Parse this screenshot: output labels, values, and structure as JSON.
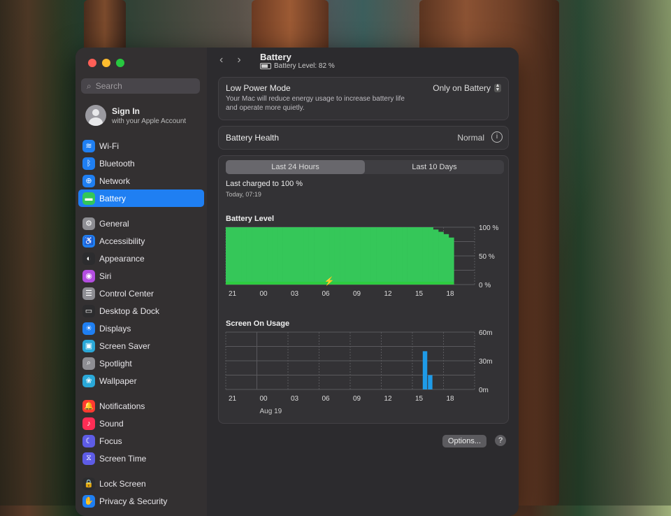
{
  "window": {
    "title": "Battery",
    "subtitle": "Battery Level: 82 %"
  },
  "sidebar": {
    "search_placeholder": "Search",
    "account": {
      "title": "Sign In",
      "subtitle": "with your Apple Account"
    },
    "groups": [
      [
        {
          "label": "Wi-Fi",
          "icon": "wifi-icon",
          "color": "#1f7ff2",
          "glyph": "≋"
        },
        {
          "label": "Bluetooth",
          "icon": "bluetooth-icon",
          "color": "#1f7ff2",
          "glyph": "ᛒ"
        },
        {
          "label": "Network",
          "icon": "globe-icon",
          "color": "#1f7ff2",
          "glyph": "⊕"
        },
        {
          "label": "Battery",
          "icon": "battery-icon",
          "color": "#34c759",
          "glyph": "▬",
          "active": true
        }
      ],
      [
        {
          "label": "General",
          "icon": "gear-icon",
          "color": "#8e8e93",
          "glyph": "⚙"
        },
        {
          "label": "Accessibility",
          "icon": "accessibility-icon",
          "color": "#1f7ff2",
          "glyph": "♿"
        },
        {
          "label": "Appearance",
          "icon": "appearance-icon",
          "color": "#2c2c2e",
          "glyph": "◐"
        },
        {
          "label": "Siri",
          "icon": "siri-icon",
          "color": "#b34de0",
          "glyph": "◉"
        },
        {
          "label": "Control Center",
          "icon": "control-center-icon",
          "color": "#8e8e93",
          "glyph": "☰"
        },
        {
          "label": "Desktop & Dock",
          "icon": "dock-icon",
          "color": "#2c2c2e",
          "glyph": "▭"
        },
        {
          "label": "Displays",
          "icon": "displays-icon",
          "color": "#1f7ff2",
          "glyph": "☀"
        },
        {
          "label": "Screen Saver",
          "icon": "screen-saver-icon",
          "color": "#2aa8d8",
          "glyph": "▣"
        },
        {
          "label": "Spotlight",
          "icon": "spotlight-icon",
          "color": "#8e8e93",
          "glyph": "⌕"
        },
        {
          "label": "Wallpaper",
          "icon": "wallpaper-icon",
          "color": "#2aa8d8",
          "glyph": "❀"
        }
      ],
      [
        {
          "label": "Notifications",
          "icon": "notifications-icon",
          "color": "#ff3b30",
          "glyph": "🔔"
        },
        {
          "label": "Sound",
          "icon": "sound-icon",
          "color": "#ff2d55",
          "glyph": "♪"
        },
        {
          "label": "Focus",
          "icon": "focus-icon",
          "color": "#5e5ce6",
          "glyph": "☾"
        },
        {
          "label": "Screen Time",
          "icon": "screen-time-icon",
          "color": "#5e5ce6",
          "glyph": "⧖"
        }
      ],
      [
        {
          "label": "Lock Screen",
          "icon": "lock-icon",
          "color": "#2c2c2e",
          "glyph": "🔒"
        },
        {
          "label": "Privacy & Security",
          "icon": "privacy-icon",
          "color": "#1f7ff2",
          "glyph": "✋"
        }
      ]
    ]
  },
  "low_power": {
    "title": "Low Power Mode",
    "description": "Your Mac will reduce energy usage to increase battery life and operate more quietly.",
    "value": "Only on Battery"
  },
  "battery_health": {
    "label": "Battery Health",
    "value": "Normal"
  },
  "tabs": {
    "first": "Last 24 Hours",
    "second": "Last 10 Days"
  },
  "last_charged": {
    "title": "Last charged to 100 %",
    "time": "Today, 07:19"
  },
  "charts": [
    {
      "type": "bar",
      "title": "Battery Level",
      "x_ticks": [
        "21",
        "00",
        "03",
        "06",
        "09",
        "12",
        "15",
        "18"
      ],
      "y_ticks": [
        "100 %",
        "50 %",
        "0 %"
      ],
      "ylim": [
        0,
        100
      ],
      "unit": "%",
      "color": "#35c759",
      "values": [
        100,
        100,
        100,
        100,
        100,
        100,
        100,
        100,
        100,
        100,
        100,
        100,
        100,
        100,
        100,
        100,
        100,
        100,
        100,
        100,
        100,
        100,
        100,
        100,
        100,
        100,
        100,
        100,
        100,
        100,
        100,
        100,
        100,
        100,
        100,
        100,
        100,
        100,
        100,
        100,
        96,
        92,
        88,
        82
      ],
      "charging_indicator": "charging-bolt-icon"
    },
    {
      "type": "bar",
      "title": "Screen On Usage",
      "x_ticks": [
        "21",
        "00",
        "03",
        "06",
        "09",
        "12",
        "15",
        "18"
      ],
      "x_sublabel": "Aug 19",
      "y_ticks": [
        "60m",
        "30m",
        "0m"
      ],
      "ylim": [
        0,
        60
      ],
      "color": "#1e9be8",
      "bars": [
        {
          "slot": 38,
          "value": 40
        },
        {
          "slot": 39,
          "value": 15
        }
      ]
    }
  ],
  "footer": {
    "options_label": "Options...",
    "help_label": "?"
  }
}
